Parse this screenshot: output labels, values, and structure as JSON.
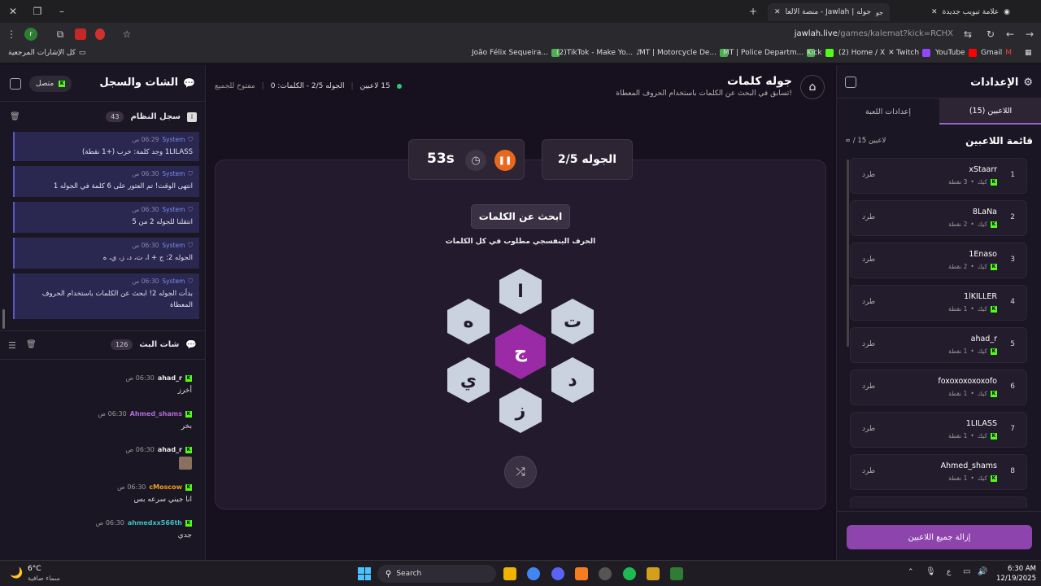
{
  "browser": {
    "tabs": [
      {
        "title": "جوله | Jawlah - منصة الألعاب الت...",
        "active": true
      },
      {
        "title": "علامة تبويب جديدة",
        "active": false
      }
    ],
    "url_host": "jawlah.live",
    "url_path": "/games/kalemat?kick=RCHX",
    "bookmarks": [
      {
        "label": "كل الإشارات المرجعية"
      },
      {
        "label": "João Félix Sequeira..."
      },
      {
        "label": "(2)TikTok - Make Yo..."
      },
      {
        "label": "MT | Motorcycle De..."
      },
      {
        "label": "MT | Police Departm..."
      },
      {
        "label": "Kick"
      },
      {
        "label": "(2) Home / X"
      },
      {
        "label": "Twitch"
      },
      {
        "label": "YouTube"
      },
      {
        "label": "Gmail"
      }
    ]
  },
  "left": {
    "title": "الشات والسجل",
    "status": "متصل",
    "system_log": {
      "title": "سجل النظام",
      "count": "43",
      "entries": [
        {
          "name": "System",
          "time": "06:29 ص",
          "text": "1LILASS وجد كلمة: خرب (+1 نقطة)"
        },
        {
          "name": "System",
          "time": "06:30 ص",
          "text": "انتهى الوقت! تم العثور على 6 كلمة في الجوله 1"
        },
        {
          "name": "System",
          "time": "06:30 ص",
          "text": "انتقلنا للجوله 2 من 5"
        },
        {
          "name": "System",
          "time": "06:30 ص",
          "text": "الجوله 2: ج + ا، ت، د، ز، ي، ه"
        },
        {
          "name": "System",
          "time": "06:30 ص",
          "text": "بدأت الجوله 2! ابحث عن الكلمات باستخدام الحروف المعطاة"
        }
      ]
    },
    "stream_chat": {
      "title": "شات البث",
      "count": "126",
      "messages": [
        {
          "name": "ahad_r",
          "time": "06:30 ص",
          "text": "أخرز",
          "color": "#e8e8e8"
        },
        {
          "name": "Ahmed_shams",
          "time": "06:30 ص",
          "text": "بخر",
          "color": "#b06ad8"
        },
        {
          "name": "ahad_r",
          "time": "06:30 ص",
          "text": "",
          "color": "#e8e8e8"
        },
        {
          "name": "cMoscow",
          "time": "06:30 ص",
          "text": "انا جيني سرعه بس",
          "color": "#f0a020"
        },
        {
          "name": "ahmedxx566th",
          "time": "06:30 ص",
          "text": "جدي",
          "color": "#3ec0c0"
        }
      ]
    }
  },
  "center": {
    "title": "جوله كلمات",
    "subtitle": "تسابق في البحث عن الكلمات باستخدام الحروف المعطاة!",
    "players_count": "15 لاعبين",
    "round_info": "الجوله 2/5 - الكلمات: 0",
    "open_label": "مفتوح للجميع",
    "round_box": "الجوله 2/5",
    "timer": "53s",
    "search_label": "ابحث عن الكلمات",
    "hint": "الحرف البنفسجي مطلوب في كل الكلمات",
    "letters": {
      "center": "ج",
      "top": "ا",
      "top_right": "ت",
      "bottom_right": "د",
      "bottom": "ز",
      "bottom_left": "ي",
      "top_left": "ه"
    }
  },
  "right": {
    "title": "الإعدادات",
    "tab_players": "اللاعبين (15)",
    "tab_settings": "إعدادات اللعبة",
    "list_title": "قائمة اللاعبين",
    "list_count": "∞ / 15 لاعبين",
    "platform": "كيك",
    "kick_label": "طرد",
    "players": [
      {
        "rank": "1",
        "name": "xStaarr",
        "points": "3 نقطة"
      },
      {
        "rank": "2",
        "name": "8LaNa",
        "points": "2 نقطة"
      },
      {
        "rank": "3",
        "name": "1Enaso",
        "points": "2 نقطة"
      },
      {
        "rank": "4",
        "name": "1lKILLER",
        "points": "1 نقطة"
      },
      {
        "rank": "5",
        "name": "ahad_r",
        "points": "1 نقطة"
      },
      {
        "rank": "6",
        "name": "foxoxoxoxoxofo",
        "points": "1 نقطة"
      },
      {
        "rank": "7",
        "name": "1LILASS",
        "points": "1 نقطة"
      },
      {
        "rank": "8",
        "name": "Ahmed_shams",
        "points": "1 نقطة"
      }
    ],
    "remove_all": "إزالة جميع اللاعبين"
  },
  "taskbar": {
    "weather_temp": "6°C",
    "weather_desc": "سماء صافية",
    "search": "Search",
    "time": "6:30 AM",
    "date": "12/19/2025",
    "lang": "ع"
  }
}
